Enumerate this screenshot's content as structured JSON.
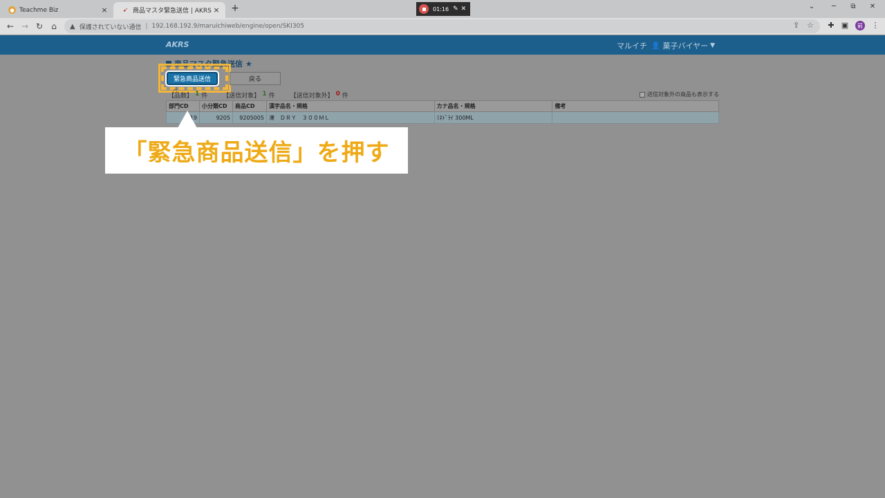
{
  "browser": {
    "tabs": [
      {
        "title": "Teachme Biz",
        "close": "×"
      },
      {
        "title": "商品マスタ緊急送信 | AKRS",
        "close": "×"
      }
    ],
    "new_tab": "+",
    "recording": {
      "time": "01:16"
    },
    "window_controls": {
      "minimize": "─",
      "maximize": "⧉",
      "close": "✕",
      "dropdown": "⌄"
    },
    "nav": {
      "back": "←",
      "forward": "→",
      "reload": "↻",
      "home": "⌂"
    },
    "address": {
      "security_label": "保護されていない通信",
      "separator": "|",
      "url": "192.168.192.9/maruichiweb/engine/open/SKI305"
    },
    "profile_initial": "前"
  },
  "app": {
    "brand": "AKRS",
    "company": "マルイチ",
    "user": "菓子バイヤー",
    "page_title": "商品マスタ緊急送信",
    "buttons": {
      "emergency_send": "緊急商品送信",
      "back": "戻る"
    },
    "counts": {
      "items_label": "【品数】",
      "items_value": "1",
      "items_unit": "件",
      "target_label": "【送信対象】",
      "target_value": "1",
      "target_unit": "件",
      "excluded_label": "【送信対象外】",
      "excluded_value": "0",
      "excluded_unit": "件"
    },
    "show_excluded_label": "送信対象外の商品も表示する",
    "table": {
      "headers": [
        "部門CD",
        "小分類CD",
        "商品CD",
        "漢字品名・規格",
        "カナ品名・規格",
        "備考"
      ],
      "rows": [
        [
          "19",
          "9205",
          "9205005",
          "凍　ＤＲＹ　３００ＭＬ",
          "ﾐﾈﾄﾞﾗｲ 300ML",
          ""
        ]
      ]
    }
  },
  "annotation": {
    "callout_text": "「緊急商品送信」を押す",
    "highlight_color": "#f3b63c",
    "text_color": "#eeaa16"
  }
}
